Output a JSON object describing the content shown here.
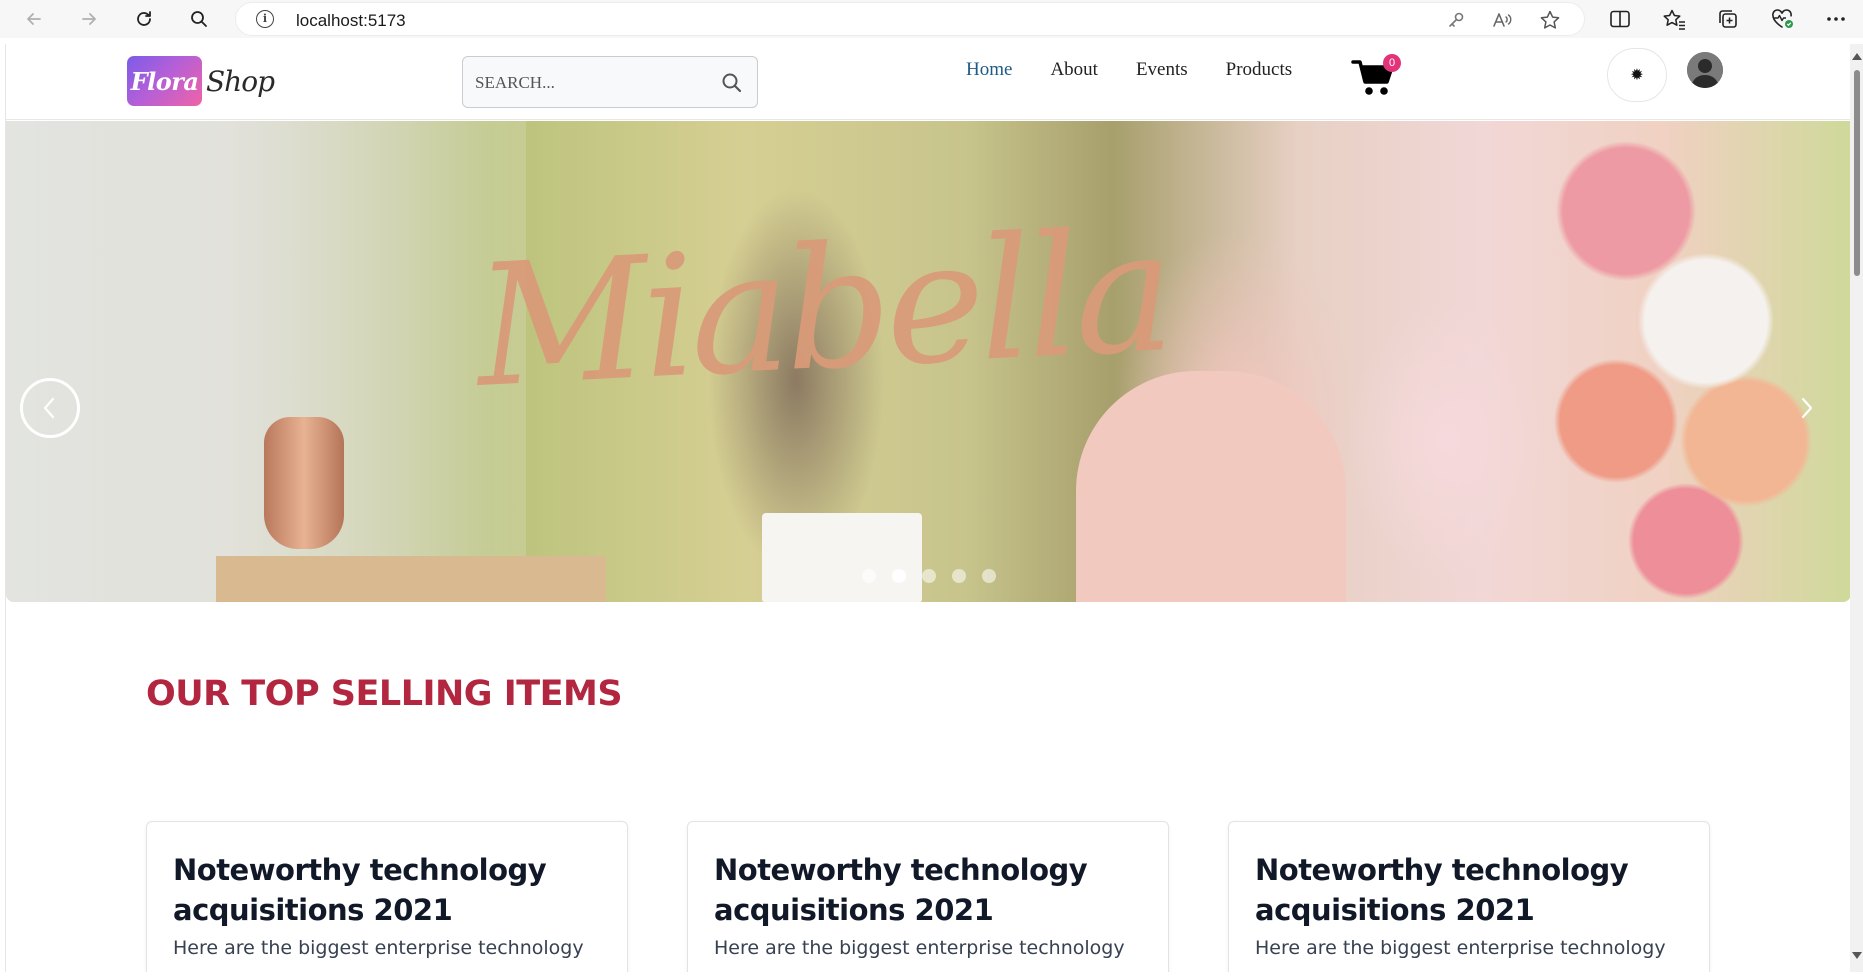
{
  "browser": {
    "url": "localhost:5173"
  },
  "site": {
    "logo_badge": "Flora",
    "logo_word": "Shop",
    "search_placeholder": "SEARCH...",
    "nav": [
      {
        "label": "Home",
        "active": true
      },
      {
        "label": "About",
        "active": false
      },
      {
        "label": "Events",
        "active": false
      },
      {
        "label": "Products",
        "active": false
      }
    ],
    "cart_count": "0",
    "theme_icon": "✹"
  },
  "hero": {
    "lettering": "Miabella",
    "slide_count": 5,
    "active_slide": 2
  },
  "section": {
    "title": "OUR TOP SELLING ITEMS"
  },
  "cards": [
    {
      "title": "Noteworthy technology acquisitions 2021",
      "text": "Here are the biggest enterprise technology"
    },
    {
      "title": "Noteworthy technology acquisitions 2021",
      "text": "Here are the biggest enterprise technology"
    },
    {
      "title": "Noteworthy technology acquisitions 2021",
      "text": "Here are the biggest enterprise technology"
    }
  ],
  "colors": {
    "accent": "#b3263f",
    "nav_active": "#1e5a86",
    "cart_badge": "#e2347a"
  },
  "icons": {
    "browser": [
      "back-icon",
      "forward-icon",
      "refresh-icon",
      "search-icon",
      "info-icon",
      "key-icon",
      "read-aloud-icon",
      "favorite-star-icon",
      "split-screen-icon",
      "favorites-icon",
      "collections-icon",
      "health-icon",
      "more-icon"
    ],
    "site": [
      "search-icon",
      "cart-icon",
      "theme-icon",
      "avatar-icon",
      "chevron-left-icon",
      "chevron-right-icon"
    ]
  }
}
